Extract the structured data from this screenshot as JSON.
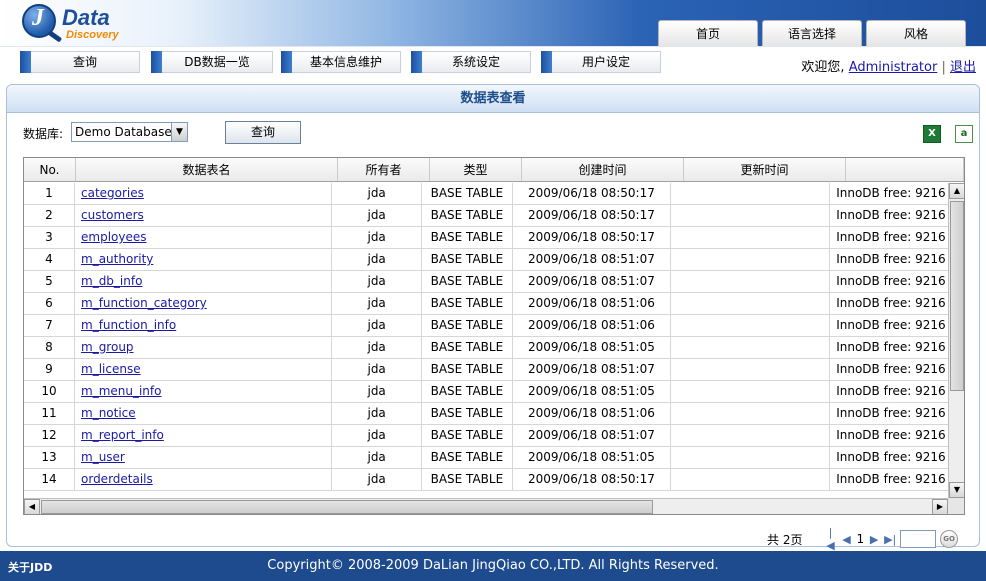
{
  "header": {
    "logo_main": "Data",
    "logo_sub": "Discovery",
    "tabs": [
      "首页",
      "语言选择",
      "风格"
    ]
  },
  "nav": {
    "items": [
      "查询",
      "DB数据一览",
      "基本信息维护",
      "系统设定",
      "用户设定"
    ],
    "welcome": "欢迎您,",
    "user": "Administrator",
    "separator": "|",
    "logout": "退出"
  },
  "panel": {
    "title": "数据表查看",
    "db_label": "数据库:",
    "db_value": "Demo Database",
    "query_button": "查询"
  },
  "table": {
    "columns": [
      "No.",
      "数据表名",
      "所有者",
      "类型",
      "创建时间",
      "更新时间",
      ""
    ],
    "rows": [
      {
        "no": "1",
        "name": "categories",
        "owner": "jda",
        "type": "BASE TABLE",
        "created": "2009/06/18 08:50:17",
        "updated": "",
        "comment": "InnoDB free: 9216"
      },
      {
        "no": "2",
        "name": "customers",
        "owner": "jda",
        "type": "BASE TABLE",
        "created": "2009/06/18 08:50:17",
        "updated": "",
        "comment": "InnoDB free: 9216"
      },
      {
        "no": "3",
        "name": "employees",
        "owner": "jda",
        "type": "BASE TABLE",
        "created": "2009/06/18 08:50:17",
        "updated": "",
        "comment": "InnoDB free: 9216"
      },
      {
        "no": "4",
        "name": "m_authority",
        "owner": "jda",
        "type": "BASE TABLE",
        "created": "2009/06/18 08:51:07",
        "updated": "",
        "comment": "InnoDB free: 9216"
      },
      {
        "no": "5",
        "name": "m_db_info",
        "owner": "jda",
        "type": "BASE TABLE",
        "created": "2009/06/18 08:51:07",
        "updated": "",
        "comment": "InnoDB free: 9216"
      },
      {
        "no": "6",
        "name": "m_function_category",
        "owner": "jda",
        "type": "BASE TABLE",
        "created": "2009/06/18 08:51:06",
        "updated": "",
        "comment": "InnoDB free: 9216"
      },
      {
        "no": "7",
        "name": "m_function_info",
        "owner": "jda",
        "type": "BASE TABLE",
        "created": "2009/06/18 08:51:06",
        "updated": "",
        "comment": "InnoDB free: 9216"
      },
      {
        "no": "8",
        "name": "m_group",
        "owner": "jda",
        "type": "BASE TABLE",
        "created": "2009/06/18 08:51:05",
        "updated": "",
        "comment": "InnoDB free: 9216"
      },
      {
        "no": "9",
        "name": "m_license",
        "owner": "jda",
        "type": "BASE TABLE",
        "created": "2009/06/18 08:51:07",
        "updated": "",
        "comment": "InnoDB free: 9216"
      },
      {
        "no": "10",
        "name": "m_menu_info",
        "owner": "jda",
        "type": "BASE TABLE",
        "created": "2009/06/18 08:51:05",
        "updated": "",
        "comment": "InnoDB free: 9216"
      },
      {
        "no": "11",
        "name": "m_notice",
        "owner": "jda",
        "type": "BASE TABLE",
        "created": "2009/06/18 08:51:06",
        "updated": "",
        "comment": "InnoDB free: 9216"
      },
      {
        "no": "12",
        "name": "m_report_info",
        "owner": "jda",
        "type": "BASE TABLE",
        "created": "2009/06/18 08:51:07",
        "updated": "",
        "comment": "InnoDB free: 9216"
      },
      {
        "no": "13",
        "name": "m_user",
        "owner": "jda",
        "type": "BASE TABLE",
        "created": "2009/06/18 08:51:05",
        "updated": "",
        "comment": "InnoDB free: 9216"
      },
      {
        "no": "14",
        "name": "orderdetails",
        "owner": "jda",
        "type": "BASE TABLE",
        "created": "2009/06/18 08:50:17",
        "updated": "",
        "comment": "InnoDB free: 9216"
      }
    ]
  },
  "pager": {
    "total": "共 2页",
    "current": "1",
    "go": "GO"
  },
  "footer": {
    "about": "关于JDD",
    "copyright": "Copyright© 2008-2009 DaLian JingQiao CO.,LTD. All Rights Reserved."
  }
}
